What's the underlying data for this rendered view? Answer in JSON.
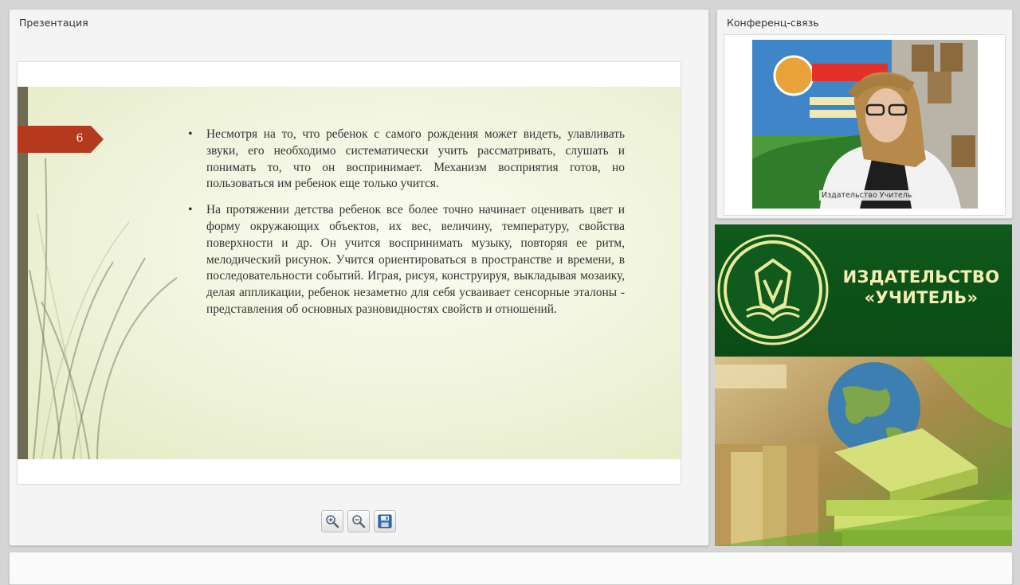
{
  "presentation": {
    "title": "Презентация",
    "slide": {
      "number": "6",
      "bullets": [
        "Несмотря на то, что ребенок с самого рождения может видеть, улавливать звуки, его необходимо систематически учить рассматривать, слушать и понимать то, что он воспринимает. Механизм восприятия готов, но пользоваться им ребенок еще только учится.",
        "На протяжении детства ребенок все более точно начинает оценивать цвет и форму окружающих объектов, их вес, величину, температуру, свойства поверхности и др. Он учится воспринимать музыку, повторяя ее ритм, мелодический рисунок. Учится ориентироваться в пространстве и времени, в последовательности событий. Играя, рисуя, конструируя, выкладывая мозаику, делая аппликации, ребенок незаметно для себя усваивает сенсорные эталоны - представления об основных разновидностях свойств и отношений."
      ],
      "accent_color": "#b5391d"
    },
    "toolbar": {
      "icons": [
        "zoom-in-icon",
        "zoom-out-icon",
        "save-icon"
      ]
    }
  },
  "conference": {
    "title": "Конференц-связь",
    "video_label": "Издательство Учитель"
  },
  "ad": {
    "brand_line1": "ИЗДАТЕЛЬСТВО",
    "brand_line2": "«УЧИТЕЛЬ»",
    "brand_color": "#0f5a1c"
  }
}
